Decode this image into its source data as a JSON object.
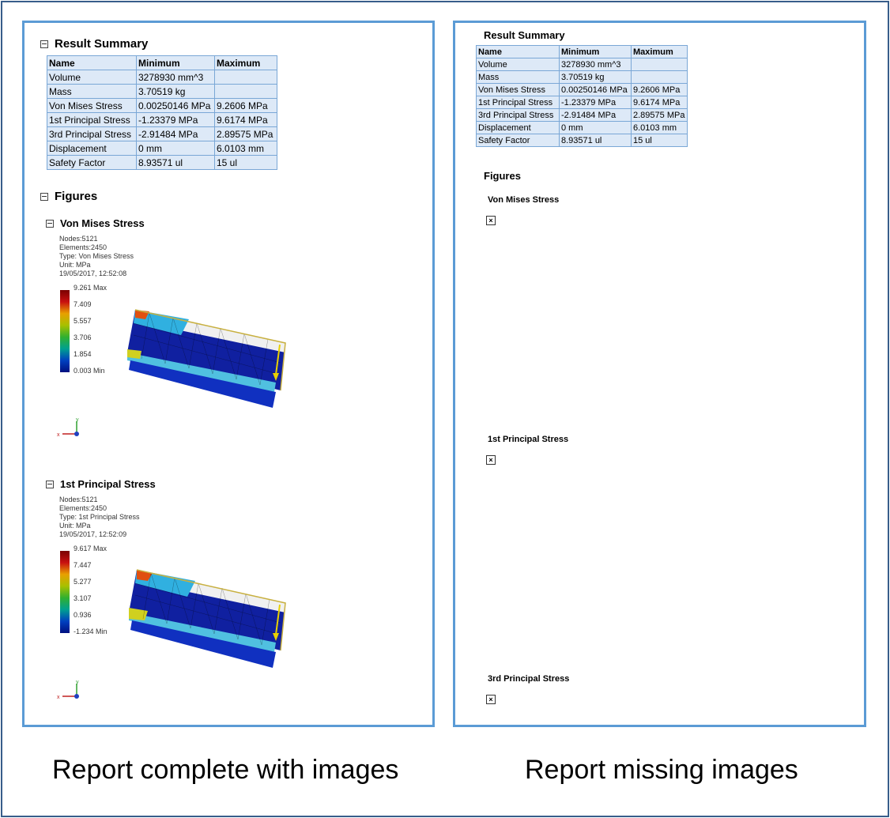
{
  "left": {
    "result_summary_title": "Result Summary",
    "table": {
      "headers": [
        "Name",
        "Minimum",
        "Maximum"
      ],
      "rows": [
        [
          "Volume",
          "3278930 mm^3",
          ""
        ],
        [
          "Mass",
          "3.70519 kg",
          ""
        ],
        [
          "Von Mises Stress",
          "0.00250146 MPa",
          "9.2606 MPa"
        ],
        [
          "1st Principal Stress",
          "-1.23379 MPa",
          "9.6174 MPa"
        ],
        [
          "3rd Principal Stress",
          "-2.91484 MPa",
          "2.89575 MPa"
        ],
        [
          "Displacement",
          "0 mm",
          "6.0103 mm"
        ],
        [
          "Safety Factor",
          "8.93571 ul",
          "15 ul"
        ]
      ]
    },
    "figures_title": "Figures",
    "fig1": {
      "title": "Von Mises Stress",
      "meta": [
        "Nodes:5121",
        "Elements:2450",
        "Type: Von Mises Stress",
        "Unit: MPa",
        "19/05/2017, 12:52:08"
      ],
      "legend": [
        "9.261 Max",
        "7.409",
        "5.557",
        "3.706",
        "1.854",
        "0.003 Min"
      ]
    },
    "fig2": {
      "title": "1st Principal Stress",
      "meta": [
        "Nodes:5121",
        "Elements:2450",
        "Type: 1st Principal Stress",
        "Unit: MPa",
        "19/05/2017, 12:52:09"
      ],
      "legend": [
        "9.617 Max",
        "7.447",
        "5.277",
        "3.107",
        "0.936",
        "-1.234 Min"
      ]
    }
  },
  "right": {
    "result_summary_title": "Result Summary",
    "table": {
      "headers": [
        "Name",
        "Minimum",
        "Maximum"
      ],
      "rows": [
        [
          "Volume",
          "3278930 mm^3",
          ""
        ],
        [
          "Mass",
          "3.70519 kg",
          ""
        ],
        [
          "Von Mises Stress",
          "0.00250146 MPa",
          "9.2606 MPa"
        ],
        [
          "1st Principal Stress",
          "-1.23379 MPa",
          "9.6174 MPa"
        ],
        [
          "3rd Principal Stress",
          "-2.91484 MPa",
          "2.89575 MPa"
        ],
        [
          "Displacement",
          "0 mm",
          "6.0103 mm"
        ],
        [
          "Safety Factor",
          "8.93571 ul",
          "15 ul"
        ]
      ]
    },
    "figures_title": "Figures",
    "fig_titles": [
      "Von Mises Stress",
      "1st Principal Stress",
      "3rd Principal Stress"
    ]
  },
  "captions": {
    "left": "Report complete with images",
    "right": "Report missing images"
  },
  "triad_labels": {
    "x": "x",
    "y": "y"
  },
  "broken_image_icon": "broken-image-icon"
}
